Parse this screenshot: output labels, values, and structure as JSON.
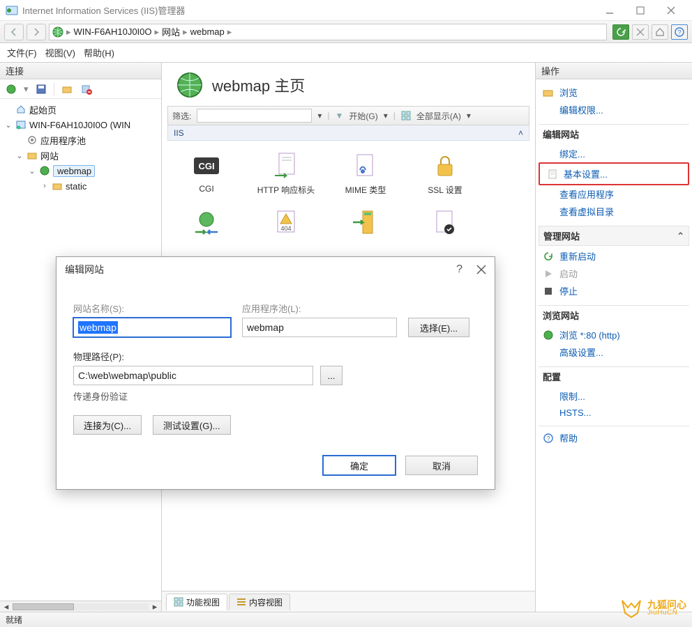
{
  "window": {
    "title": "Internet Information Services (IIS)管理器",
    "status": "就绪"
  },
  "breadcrumb": {
    "items": [
      "WIN-F6AH10J0I0O",
      "网站",
      "webmap"
    ]
  },
  "menubar": {
    "file": "文件(F)",
    "view": "视图(V)",
    "help": "帮助(H)"
  },
  "connections": {
    "heading": "连接",
    "tree": {
      "start_page": "起始页",
      "server_name": "WIN-F6AH10J0I0O (WIN",
      "app_pools": "应用程序池",
      "sites": "网站",
      "site_webmap": "webmap",
      "folder_static": "static"
    }
  },
  "center": {
    "page_title": "webmap 主页",
    "filter": {
      "label": "筛选:",
      "placeholder": "",
      "start": "开始(G)",
      "show_all": "全部显示(A)"
    },
    "group_iis": "IIS",
    "features_row1": {
      "cgi": "CGI",
      "http_headers": "HTTP 响应标头",
      "mime": "MIME 类型",
      "ssl": "SSL 设置"
    },
    "view_tabs": {
      "features": "功能视图",
      "content": "内容视图"
    }
  },
  "actions": {
    "heading": "操作",
    "browse_explore": "浏览",
    "edit_permissions": "编辑权限...",
    "edit_site_heading": "编辑网站",
    "bindings": "绑定...",
    "basic_settings": "基本设置...",
    "view_apps": "查看应用程序",
    "view_vdirs": "查看虚拟目录",
    "manage_site_heading": "管理网站",
    "restart": "重新启动",
    "start": "启动",
    "stop": "停止",
    "browse_site_heading": "浏览网站",
    "browse_80": "浏览 *:80 (http)",
    "advanced": "高级设置...",
    "config_heading": "配置",
    "limits": "限制...",
    "hsts": "HSTS...",
    "help": "帮助"
  },
  "dialog": {
    "title": "编辑网站",
    "site_name_label": "网站名称(S):",
    "site_name_value": "webmap",
    "app_pool_label": "应用程序池(L):",
    "app_pool_value": "webmap",
    "select_btn": "选择(E)...",
    "physical_path_label": "物理路径(P):",
    "physical_path_value": "C:\\web\\webmap\\public",
    "browse_btn": "...",
    "passthrough_auth": "传递身份验证",
    "connect_as_btn": "连接为(C)...",
    "test_settings_btn": "测试设置(G)...",
    "ok_btn": "确定",
    "cancel_btn": "取消"
  },
  "watermark": {
    "cn": "九狐问心",
    "en": "JiuHuCN"
  }
}
